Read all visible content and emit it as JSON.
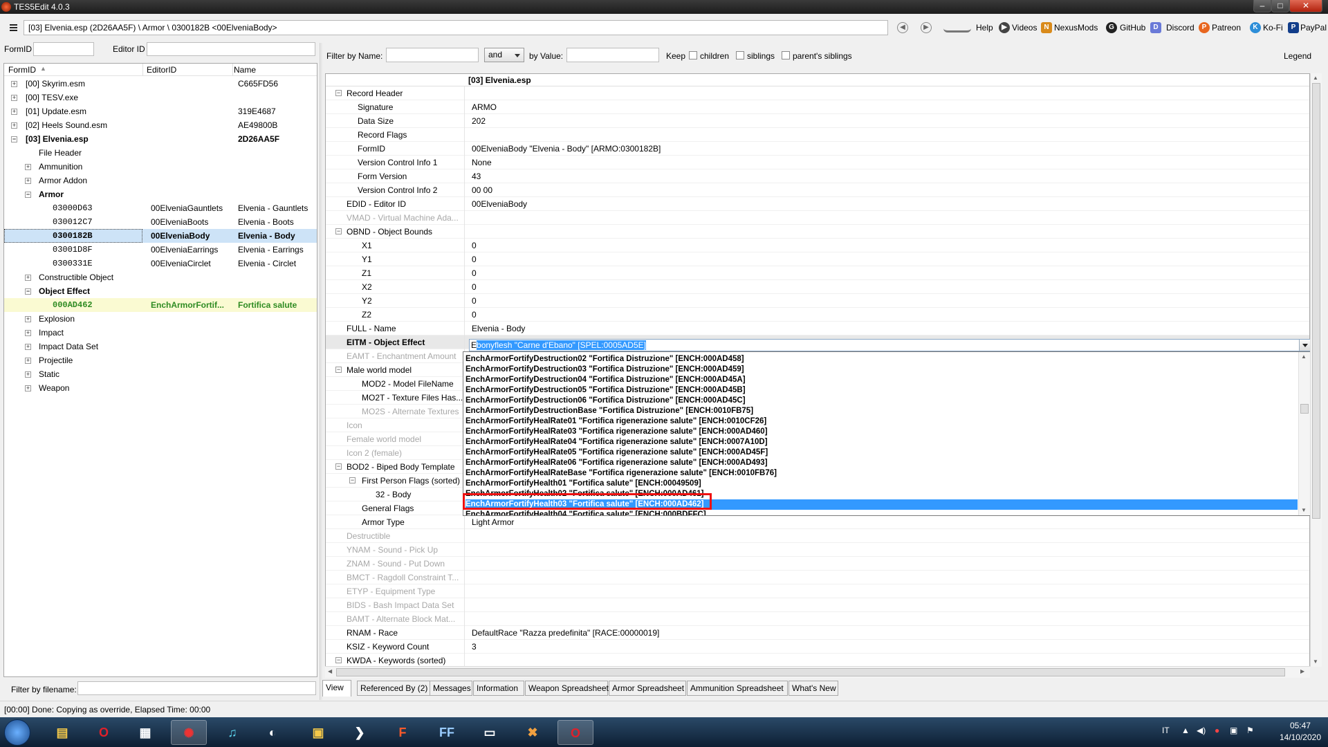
{
  "window": {
    "title": "TES5Edit 4.0.3"
  },
  "toolbar": {
    "path": "[03] Elvenia.esp (2D26AA5F) \\ Armor \\ 0300182B <00ElveniaBody>",
    "links": [
      "Help",
      "Videos",
      "NexusMods",
      "GitHub",
      "Discord",
      "Patreon",
      "Ko-Fi",
      "PayPal"
    ]
  },
  "left": {
    "formid_label": "FormID",
    "editorid_label": "Editor ID",
    "columns": [
      "FormID",
      "EditorID",
      "Name"
    ],
    "filter_label": "Filter by filename:",
    "rows": [
      {
        "formid": "[00] Skyrim.esm",
        "editorid": "",
        "name": "C665FD56"
      },
      {
        "formid": "[00] TESV.exe",
        "editorid": "",
        "name": ""
      },
      {
        "formid": "[01] Update.esm",
        "editorid": "",
        "name": "319E4687"
      },
      {
        "formid": "[02] Heels Sound.esm",
        "editorid": "",
        "name": "AE49800B"
      },
      {
        "formid": "[03] Elvenia.esp",
        "editorid": "",
        "name": "2D26AA5F"
      },
      {
        "formid": "File Header",
        "editorid": "",
        "name": ""
      },
      {
        "formid": "Ammunition",
        "editorid": "",
        "name": ""
      },
      {
        "formid": "Armor Addon",
        "editorid": "",
        "name": ""
      },
      {
        "formid": "Armor",
        "editorid": "",
        "name": ""
      },
      {
        "formid": "03000D63",
        "editorid": "00ElveniaGauntlets",
        "name": "Elvenia - Gauntlets"
      },
      {
        "formid": "030012C7",
        "editorid": "00ElveniaBoots",
        "name": "Elvenia - Boots"
      },
      {
        "formid": "0300182B",
        "editorid": "00ElveniaBody",
        "name": "Elvenia - Body"
      },
      {
        "formid": "03001D8F",
        "editorid": "00ElveniaEarrings",
        "name": "Elvenia - Earrings"
      },
      {
        "formid": "0300331E",
        "editorid": "00ElveniaCirclet",
        "name": "Elvenia - Circlet"
      },
      {
        "formid": "Constructible Object",
        "editorid": "",
        "name": ""
      },
      {
        "formid": "Object Effect",
        "editorid": "",
        "name": ""
      },
      {
        "formid": "000AD462",
        "editorid": "EnchArmorFortif...",
        "name": "Fortifica salute"
      },
      {
        "formid": "Explosion",
        "editorid": "",
        "name": ""
      },
      {
        "formid": "Impact",
        "editorid": "",
        "name": ""
      },
      {
        "formid": "Impact Data Set",
        "editorid": "",
        "name": ""
      },
      {
        "formid": "Projectile",
        "editorid": "",
        "name": ""
      },
      {
        "formid": "Static",
        "editorid": "",
        "name": ""
      },
      {
        "formid": "Weapon",
        "editorid": "",
        "name": ""
      }
    ]
  },
  "filter": {
    "name_label": "Filter by Name:",
    "op": "and",
    "value_label": "by Value:",
    "keep_label": "Keep",
    "children": "children",
    "siblings": "siblings",
    "parents_siblings": "parent's siblings",
    "legend": "Legend"
  },
  "record": {
    "header": "[03] Elvenia.esp",
    "rows": [
      {
        "label": "Record Header",
        "value": ""
      },
      {
        "label": "Signature",
        "value": "ARMO"
      },
      {
        "label": "Data Size",
        "value": "202"
      },
      {
        "label": "Record Flags",
        "value": ""
      },
      {
        "label": "FormID",
        "value": "00ElveniaBody \"Elvenia - Body\" [ARMO:0300182B]"
      },
      {
        "label": "Version Control Info 1",
        "value": "None"
      },
      {
        "label": "Form Version",
        "value": "43"
      },
      {
        "label": "Version Control Info 2",
        "value": "00 00"
      },
      {
        "label": "EDID - Editor ID",
        "value": "00ElveniaBody"
      },
      {
        "label": "VMAD - Virtual Machine Ada...",
        "value": ""
      },
      {
        "label": "OBND - Object Bounds",
        "value": ""
      },
      {
        "label": "X1",
        "value": "0"
      },
      {
        "label": "Y1",
        "value": "0"
      },
      {
        "label": "Z1",
        "value": "0"
      },
      {
        "label": "X2",
        "value": "0"
      },
      {
        "label": "Y2",
        "value": "0"
      },
      {
        "label": "Z2",
        "value": "0"
      },
      {
        "label": "FULL - Name",
        "value": "Elvenia - Body"
      },
      {
        "label": "EITM - Object Effect",
        "value": ""
      },
      {
        "label": "EAMT - Enchantment Amount",
        "value": ""
      },
      {
        "label": "Male world model",
        "value": ""
      },
      {
        "label": "MOD2 - Model FileName",
        "value": ""
      },
      {
        "label": "MO2T - Texture Files Has...",
        "value": ""
      },
      {
        "label": "MO2S - Alternate Textures",
        "value": ""
      },
      {
        "label": "Icon",
        "value": ""
      },
      {
        "label": "Female world model",
        "value": ""
      },
      {
        "label": "Icon 2 (female)",
        "value": ""
      },
      {
        "label": "BOD2 - Biped Body Template",
        "value": ""
      },
      {
        "label": "First Person Flags (sorted)",
        "value": ""
      },
      {
        "label": "32 - Body",
        "value": ""
      },
      {
        "label": "General Flags",
        "value": ""
      },
      {
        "label": "Armor Type",
        "value": "Light Armor"
      },
      {
        "label": "Destructible",
        "value": ""
      },
      {
        "label": "YNAM - Sound - Pick Up",
        "value": ""
      },
      {
        "label": "ZNAM - Sound - Put Down",
        "value": ""
      },
      {
        "label": "BMCT - Ragdoll Constraint T...",
        "value": ""
      },
      {
        "label": "ETYP - Equipment Type",
        "value": ""
      },
      {
        "label": "BIDS - Bash Impact Data Set",
        "value": ""
      },
      {
        "label": "BAMT - Alternate Block Mat...",
        "value": ""
      },
      {
        "label": "RNAM - Race",
        "value": "DefaultRace \"Razza predefinita\" [RACE:00000019]"
      },
      {
        "label": "KSIZ - Keyword Count",
        "value": "3"
      },
      {
        "label": "KWDA - Keywords (sorted)",
        "value": ""
      }
    ],
    "combo_first": "E",
    "combo_selected": "bonyflesh \"Carne d'Ebano\" [SPEL:0005AD5E]"
  },
  "dropdown": [
    "EnchArmorFortifyDestruction02 \"Fortifica Distruzione\" [ENCH:000AD458]",
    "EnchArmorFortifyDestruction03 \"Fortifica Distruzione\" [ENCH:000AD459]",
    "EnchArmorFortifyDestruction04 \"Fortifica Distruzione\" [ENCH:000AD45A]",
    "EnchArmorFortifyDestruction05 \"Fortifica Distruzione\" [ENCH:000AD45B]",
    "EnchArmorFortifyDestruction06 \"Fortifica Distruzione\" [ENCH:000AD45C]",
    "EnchArmorFortifyDestructionBase \"Fortifica Distruzione\" [ENCH:0010FB75]",
    "EnchArmorFortifyHealRate01 \"Fortifica rigenerazione salute\" [ENCH:0010CF26]",
    "EnchArmorFortifyHealRate03 \"Fortifica rigenerazione salute\" [ENCH:000AD460]",
    "EnchArmorFortifyHealRate04 \"Fortifica rigenerazione salute\" [ENCH:0007A10D]",
    "EnchArmorFortifyHealRate05 \"Fortifica rigenerazione salute\" [ENCH:000AD45F]",
    "EnchArmorFortifyHealRate06 \"Fortifica rigenerazione salute\" [ENCH:000AD493]",
    "EnchArmorFortifyHealRateBase \"Fortifica rigenerazione salute\" [ENCH:0010FB76]",
    "EnchArmorFortifyHealth01 \"Fortifica salute\" [ENCH:00049509]",
    "EnchArmorFortifyHealth02 \"Fortifica salute\" [ENCH:000AD461]",
    "EnchArmorFortifyHealth03 \"Fortifica salute\" [ENCH:000AD462]",
    "EnchArmorFortifyHealth04 \"Fortifica salute\" [ENCH:000BDFFC]"
  ],
  "tabs": [
    "View",
    "Referenced By (2)",
    "Messages",
    "Information",
    "Weapon Spreadsheet",
    "Armor Spreadsheet",
    "Ammunition Spreadsheet",
    "What's New"
  ],
  "status": "[00:00] Done: Copying as override, Elapsed Time: 00:00",
  "taskbar": {
    "lang": "IT",
    "time": "05:47",
    "date": "14/10/2020"
  }
}
